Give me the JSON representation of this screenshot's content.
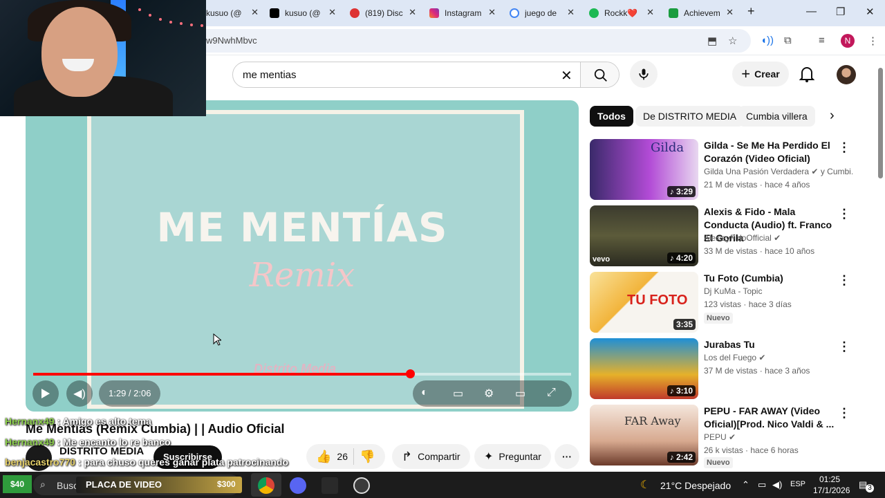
{
  "browser": {
    "tabs": [
      {
        "label": "kusuo (@",
        "color": "#333"
      },
      {
        "label": "kusuo (@",
        "color": "#000"
      },
      {
        "label": "(819) Disc",
        "color": "#d33"
      },
      {
        "label": "Instagram",
        "color": "#d6249f"
      },
      {
        "label": "juego de",
        "color": "#4285f4"
      },
      {
        "label": "Rockk❤️",
        "color": "#1db954"
      },
      {
        "label": "Achievem",
        "color": "#1a9c3f"
      }
    ],
    "url": "w9NwhMbvc",
    "profile_initial": "N"
  },
  "youtube": {
    "search_query": "me mentias",
    "create_label": "Crear",
    "video": {
      "title_overlay": "ME MENTÍAS",
      "subtitle_overlay": "Remix",
      "watermark": "Distrito Media",
      "time": "1:29 / 2:06",
      "progress": 0.7,
      "title": "Me Mentías (Remix Cumbia) | | Audio Oficial",
      "channel": "DISTRITO MEDIA",
      "subscribe_label": "Suscribirse",
      "likes": "26",
      "share_label": "Compartir",
      "ask_label": "Preguntar"
    },
    "chips": [
      "Todos",
      "De DISTRITO MEDIA",
      "Cumbia villera"
    ],
    "recommendations": [
      {
        "title": "Gilda - Se Me Ha Perdido El Corazón (Video Oficial)",
        "channel": "Gilda Una Pasión Verdadera ✔ y Cumbi...",
        "meta": "21 M de vistas · hace 4 años",
        "duration": "♪ 3:29",
        "thumb_text": "Gilda",
        "badge": ""
      },
      {
        "title": "Alexis & Fido - Mala Conducta (Audio) ft. Franco El Gorila",
        "channel": "AlexisyFidoOfficial ✔",
        "meta": "33 M de vistas · hace 10 años",
        "duration": "♪ 4:20",
        "thumb_text": "vevo",
        "badge": ""
      },
      {
        "title": "Tu Foto (Cumbia)",
        "channel": "Dj KuMa - Topic",
        "meta": "123 vistas · hace 3 días",
        "duration": "3:35",
        "thumb_text": "TU FOTO",
        "badge": "Nuevo"
      },
      {
        "title": "Jurabas Tu",
        "channel": "Los del Fuego ✔",
        "meta": "37 M de vistas · hace 3 años",
        "duration": "♪ 3:10",
        "thumb_text": "",
        "badge": ""
      },
      {
        "title": "PEPU - FAR AWAY (Video Oficial)[Prod. Nico Valdi & ...",
        "channel": "PEPU ✔",
        "meta": "26 k vistas · hace 6 horas",
        "duration": "♪ 2:42",
        "thumb_text": "FAR Away",
        "badge": "Nuevo"
      }
    ]
  },
  "chat": [
    {
      "user": "Hernanx49",
      "text": " : Amigo es alto tema"
    },
    {
      "user": "Hernanx49",
      "text": " : Me encanto lo re banco"
    },
    {
      "user": "benjacastro770",
      "text": " : para chuso queres ganar plata patrocinando"
    }
  ],
  "taskbar": {
    "price_left": "$40",
    "search_label": "Buscar",
    "banner_text": "PLACA DE VIDEO",
    "price_right": "$300",
    "weather": "21°C Despejado",
    "lang": "ESP",
    "time": "01:25",
    "date": "17/1/2026",
    "notifications": "3"
  },
  "colors": {
    "accent": "#ff0000",
    "yt_dark": "#0f0f0f",
    "chip_bg": "#f2f2f2"
  }
}
